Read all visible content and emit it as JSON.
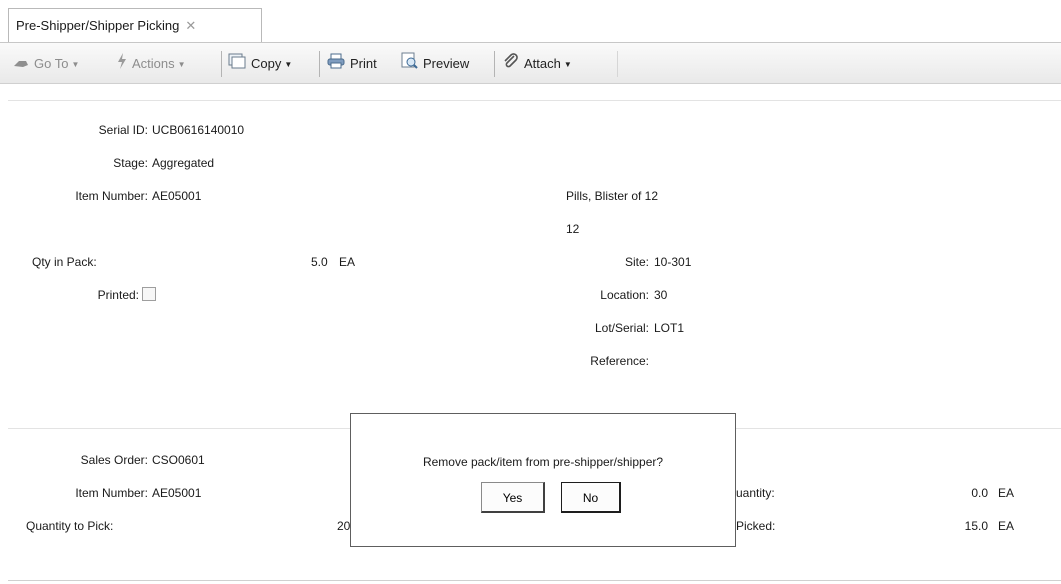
{
  "tab": {
    "title": "Pre-Shipper/Shipper Picking",
    "close": "✕"
  },
  "toolbar": {
    "goto": "Go To",
    "actions": "Actions",
    "copy": "Copy",
    "print": "Print",
    "preview": "Preview",
    "attach": "Attach",
    "dropdown_arrow": "▼"
  },
  "pack": {
    "serial_id_label": "Serial ID:",
    "serial_id": "UCB0616140010",
    "stage_label": "Stage:",
    "stage": "Aggregated",
    "item_number_label": "Item Number:",
    "item_number": "AE05001",
    "item_desc1": "Pills, Blister of 12",
    "item_desc2": "12",
    "qty_in_pack_label": "Qty in Pack:",
    "qty_in_pack": "5.0",
    "qty_uom": "EA",
    "site_label": "Site:",
    "site": "10-301",
    "printed_label": "Printed:",
    "printed": false,
    "location_label": "Location:",
    "location": "30",
    "lot_label": "Lot/Serial:",
    "lot": "LOT1",
    "reference_label": "Reference:",
    "reference": ""
  },
  "order": {
    "sales_order_label": "Sales Order:",
    "sales_order": "CSO0601",
    "item_number_label": "Item Number:",
    "item_number": "AE05001",
    "qty_to_pick_label": "Quantity to Pick:",
    "qty_to_pick_partial": "20",
    "right_label1_partial": ":",
    "right_label2_partial": "uantity:",
    "right_value2": "0.0",
    "right_uom2": "EA",
    "right_label3_partial": "Picked:",
    "right_value3": "15.0",
    "right_uom3": "EA"
  },
  "dialog": {
    "message": "Remove pack/item from pre-shipper/shipper?",
    "yes": "Yes",
    "no": "No"
  },
  "colors": {
    "separator": "#e3e3e3",
    "dialog_border": "#5e5e5e"
  }
}
